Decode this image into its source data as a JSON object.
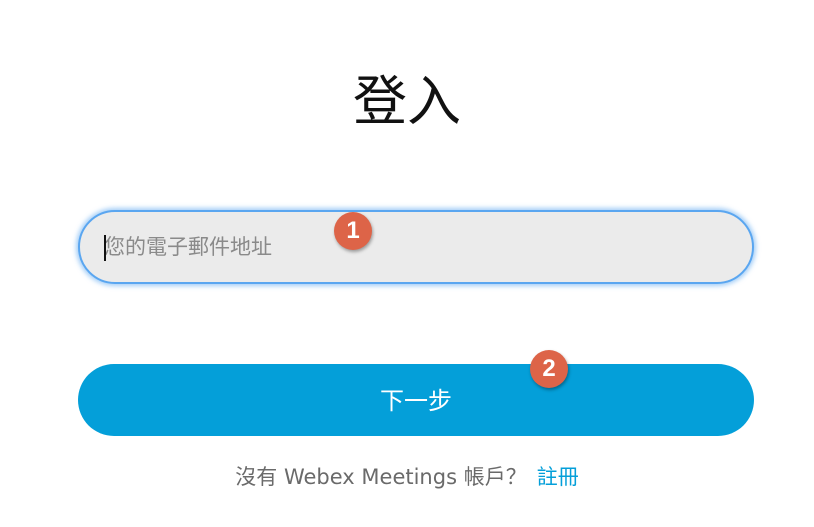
{
  "page": {
    "title": "登入"
  },
  "email": {
    "placeholder": "您的電子郵件地址",
    "value": ""
  },
  "next_button": {
    "label": "下一步"
  },
  "footer": {
    "prompt": "沒有 Webex Meetings 帳戶？",
    "signup_link": "註冊"
  },
  "annotations": {
    "marker_1": "1",
    "marker_2": "2"
  },
  "colors": {
    "accent": "#049fd9",
    "input_background": "#ebebeb",
    "input_focus_border": "#5aa6f0",
    "marker": "#dd6448",
    "title_text": "#111111",
    "footer_text": "#6a6a6a"
  }
}
